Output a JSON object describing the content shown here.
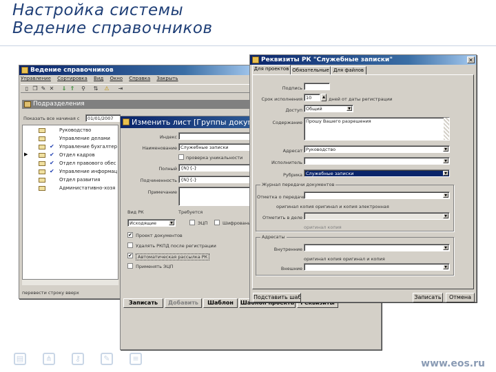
{
  "slide": {
    "title_line1": "Настройка системы",
    "title_line2": "Ведение справочников",
    "site": "www.eos.ru",
    "footer_icons": [
      "document-icon",
      "network-icon",
      "key-icon",
      "notebook-icon",
      "list-icon"
    ]
  },
  "main_window": {
    "title": "Ведение справочников",
    "menu": [
      "Управление",
      "Сортировка",
      "Вид",
      "Окно",
      "Справка",
      "Закрыть"
    ],
    "panel_title": "Подразделения",
    "date_label": "Показать все начиная с",
    "date_value": "01/01/2007",
    "tree_items": [
      {
        "label": "Руководство",
        "checked": false
      },
      {
        "label": "Управление делами",
        "checked": false
      },
      {
        "label": "Управление бухгалтер",
        "checked": true
      },
      {
        "label": "Отдел кадров",
        "checked": true
      },
      {
        "label": "Отдел правового обес",
        "checked": true
      },
      {
        "label": "Управление информац",
        "checked": true
      },
      {
        "label": "Отдел развития",
        "checked": false
      },
      {
        "label": "Администативно-хозя",
        "checked": false
      }
    ],
    "status_text": "перевести строку вверх"
  },
  "edit_window": {
    "title": "Изменить лист [Группы докум",
    "labels": {
      "index": "Индекс",
      "name": "Наименование",
      "full_number": "Полный",
      "sub_number": "Подчиненность",
      "note": "Примечание",
      "doc_type": "Вид РК",
      "require": "Требуется"
    },
    "name_value": "Служебные записки",
    "check_numbering": "проверка уникальности",
    "number_value": "{N}{-}",
    "subnumber_value": "{N}{-}",
    "doc_type_value": "Исходящие",
    "eds_label": "ЭЦП",
    "encrypt_label": "Шифрование",
    "options": [
      {
        "label": "Проект документов",
        "checked": true
      },
      {
        "label": "Удалять РКПД после регистрации",
        "checked": false
      },
      {
        "label": "Автоматическая рассылка РК",
        "checked": true
      },
      {
        "label": "Применять ЭЦП",
        "checked": false
      }
    ],
    "buttons": [
      "Записать",
      "Добавить",
      "Шаблон",
      "Шаблон проекта",
      "Реквизиты"
    ]
  },
  "props_window": {
    "title": "Реквизиты РК \"Служебные записки\"",
    "tabs": [
      "Для проектов",
      "Обязательные",
      "Для файлов"
    ],
    "labels": {
      "signature": "Подпись",
      "deadline": "Срок исполнения",
      "access": "Доступ",
      "content": "Содержание",
      "sender": "Адресат",
      "executor": "Исполнитель",
      "topic": "Рубрика"
    },
    "deadline_value": "10",
    "deadline_suffix": "дней от даты регистрации",
    "access_value": "Общий",
    "content_value": "Прошу Вашего разрешения",
    "sender_value": "Руководство",
    "topic_value": "Служебные записки",
    "group1_title": "Журнал передачи документов",
    "group1_label": "Отметка о передаче",
    "group1_radios": "оригинал  копия  оригинал и копия  электронная",
    "group1_label2": "Отметить в деле",
    "group1_radios2": "оригинал  копия",
    "group2_title": "Адресаты",
    "group2_label": "Внутренние",
    "group2_radios": "оригинал  копия  оригинал и копия",
    "group2_label2": "Внешние",
    "buttons": {
      "template": "Подставить шаблон",
      "save": "Записать",
      "cancel": "Отмена"
    }
  },
  "colors": {
    "title": "#1f3f77",
    "titlebar": "#0a246a",
    "selection": "#0a246a"
  }
}
